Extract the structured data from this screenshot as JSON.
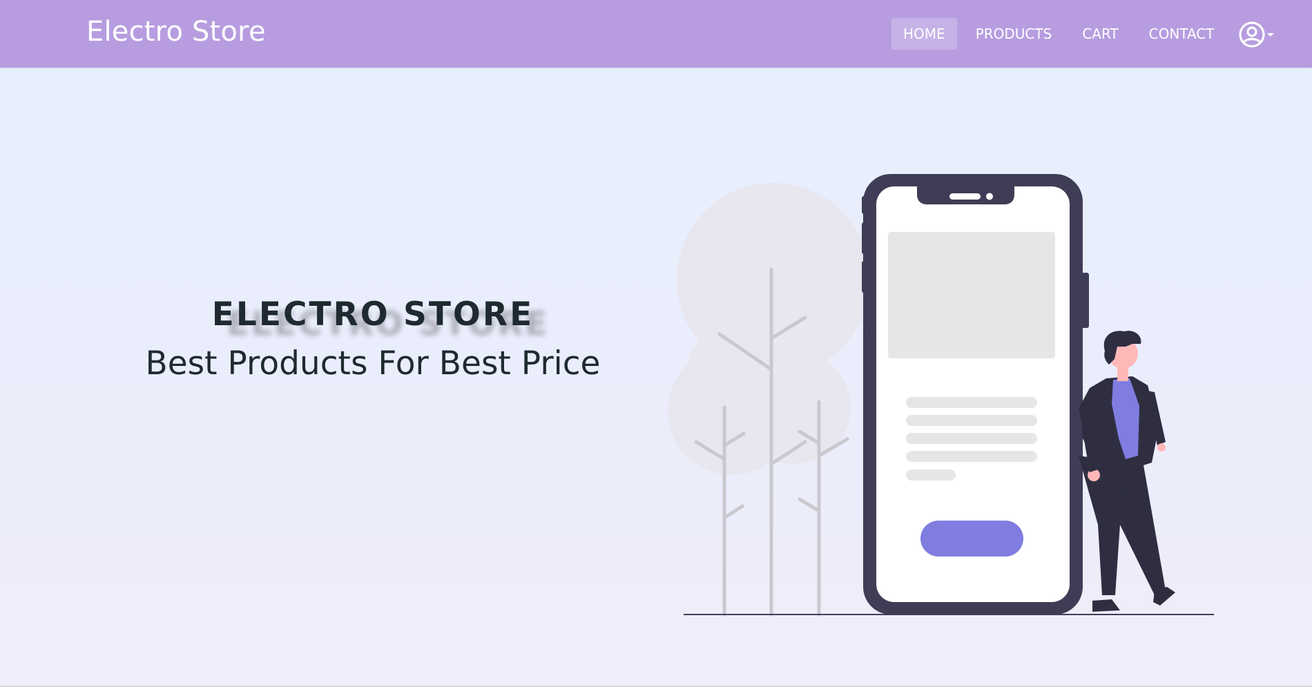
{
  "navbar": {
    "brand": "Electro Store",
    "links": [
      {
        "label": "HOME",
        "active": true
      },
      {
        "label": "PRODUCTS",
        "active": false
      },
      {
        "label": "CART",
        "active": false
      },
      {
        "label": "CONTACT",
        "active": false
      }
    ],
    "user_icon": "user-circle-icon",
    "dropdown_icon": "caret-down-icon"
  },
  "hero": {
    "title": "ELECTRO STORE",
    "subtitle": "Best Products For Best Price"
  },
  "colors": {
    "navbar": "#b79de0",
    "accent": "#7f7de0",
    "page_background": "#e8eefc",
    "text_dark": "#1e2a30",
    "phone_frame": "#3f3d56"
  }
}
